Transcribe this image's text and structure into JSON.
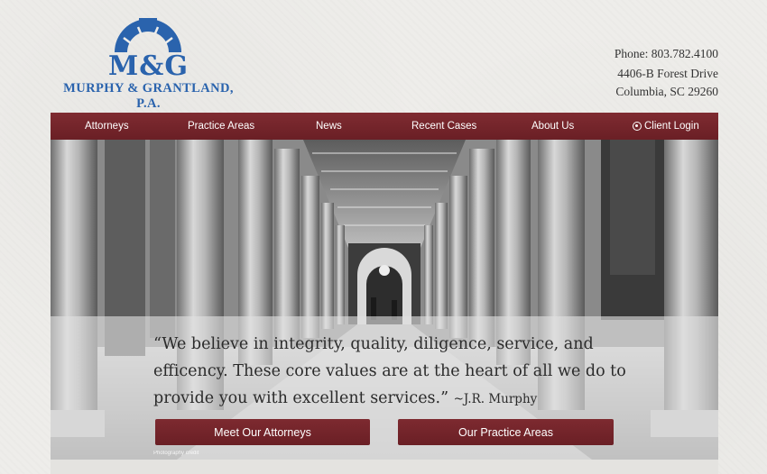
{
  "logo": {
    "monogram": "M&G",
    "firm_name": "MURPHY & GRANTLAND, P.A.",
    "brand_color": "#2a63ad"
  },
  "contact": {
    "phone": "Phone: 803.782.4100",
    "address_line1": "4406-B Forest Drive",
    "address_line2": "Columbia, SC 29260"
  },
  "nav": {
    "accent_color": "#74252b",
    "items": [
      {
        "label": "Attorneys"
      },
      {
        "label": "Practice Areas"
      },
      {
        "label": "News"
      },
      {
        "label": "Recent Cases"
      },
      {
        "label": "About Us"
      },
      {
        "label": "Client Login",
        "icon": "login-icon"
      }
    ]
  },
  "hero": {
    "quote": "“We believe in integrity, quality, diligence, service, and efficency. These core values are at the heart of all we do to provide you with excellent services.”",
    "author": "~J.R. Murphy",
    "buttons": {
      "attorneys": "Meet Our Attorneys",
      "practice": "Our Practice Areas"
    },
    "credit": "Photography credit"
  }
}
